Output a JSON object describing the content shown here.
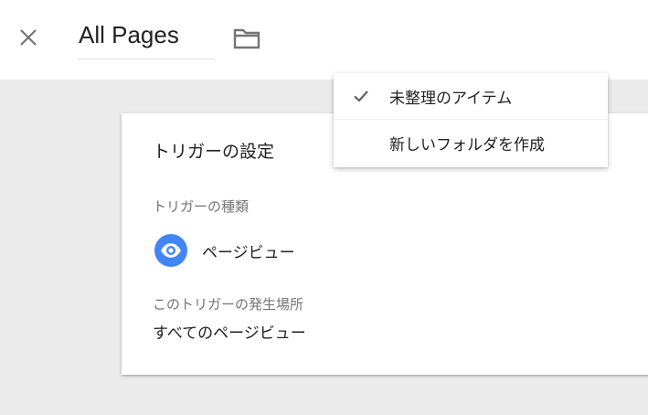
{
  "header": {
    "title": "All Pages",
    "close_icon": "close-icon",
    "folder_icon": "folder-icon"
  },
  "card": {
    "title": "トリガーの設定",
    "trigger_type_label": "トリガーの種類",
    "trigger_type_value": "ページビュー",
    "trigger_type_icon": "eye-icon",
    "fires_on_label": "このトリガーの発生場所",
    "fires_on_value": "すべてのページビュー"
  },
  "folder_menu": {
    "items": [
      {
        "label": "未整理のアイテム",
        "selected": true,
        "icon": "check-icon"
      },
      {
        "label": "新しいフォルダを作成",
        "selected": false
      }
    ]
  },
  "colors": {
    "accent_blue": "#4285f4",
    "icon_gray": "#757575",
    "background": "#ebebeb",
    "surface": "#ffffff"
  }
}
